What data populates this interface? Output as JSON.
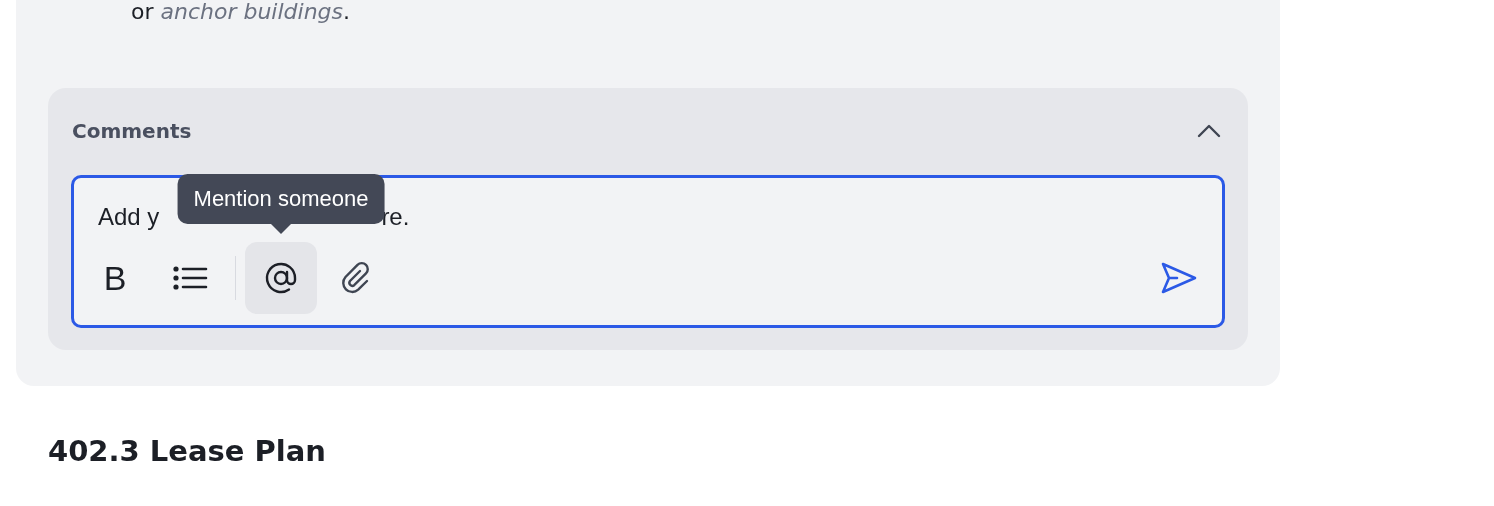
{
  "text_above": "or *anchor buildings*.",
  "comments": {
    "title": "Comments",
    "expanded": true,
    "placeholder": [
      "Add y",
      "re."
    ],
    "toolbar": [
      {
        "kind": "bold",
        "label": "B",
        "hovered": false
      },
      {
        "kind": "list",
        "hovered": false
      },
      {
        "kind": "divider"
      },
      {
        "kind": "mention",
        "hovered": true,
        "tooltip": "Mention someone"
      },
      {
        "kind": "attach",
        "hovered": false
      }
    ]
  },
  "heading": "402.3 Lease Plan"
}
